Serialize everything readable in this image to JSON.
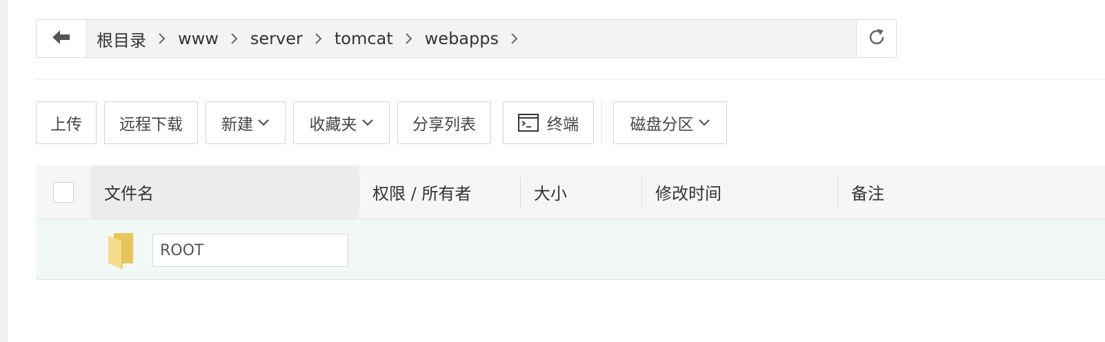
{
  "pathbar": {
    "crumbs": [
      "根目录",
      "www",
      "server",
      "tomcat",
      "webapps"
    ]
  },
  "toolbar": {
    "upload": "上传",
    "remote_download": "远程下载",
    "new": "新建",
    "favorites": "收藏夹",
    "share_list": "分享列表",
    "terminal": "终端",
    "disk_partition": "磁盘分区"
  },
  "table": {
    "headers": {
      "filename": "文件名",
      "permission_owner": "权限 / 所有者",
      "size": "大小",
      "modified": "修改时间",
      "remark": "备注"
    },
    "rows": [
      {
        "name": "ROOT",
        "type": "folder",
        "editing": true
      }
    ]
  },
  "icons": {
    "back": "arrow-left-icon",
    "refresh": "refresh-icon",
    "breadcrumb_separator": "chevron-right-icon",
    "dropdown": "chevron-down-icon",
    "terminal": "terminal-icon",
    "folder": "folder-icon"
  },
  "colors": {
    "folder": "#f2d57a",
    "row_highlight": "#f1f8f5",
    "header_bg": "#f6f6f6"
  }
}
